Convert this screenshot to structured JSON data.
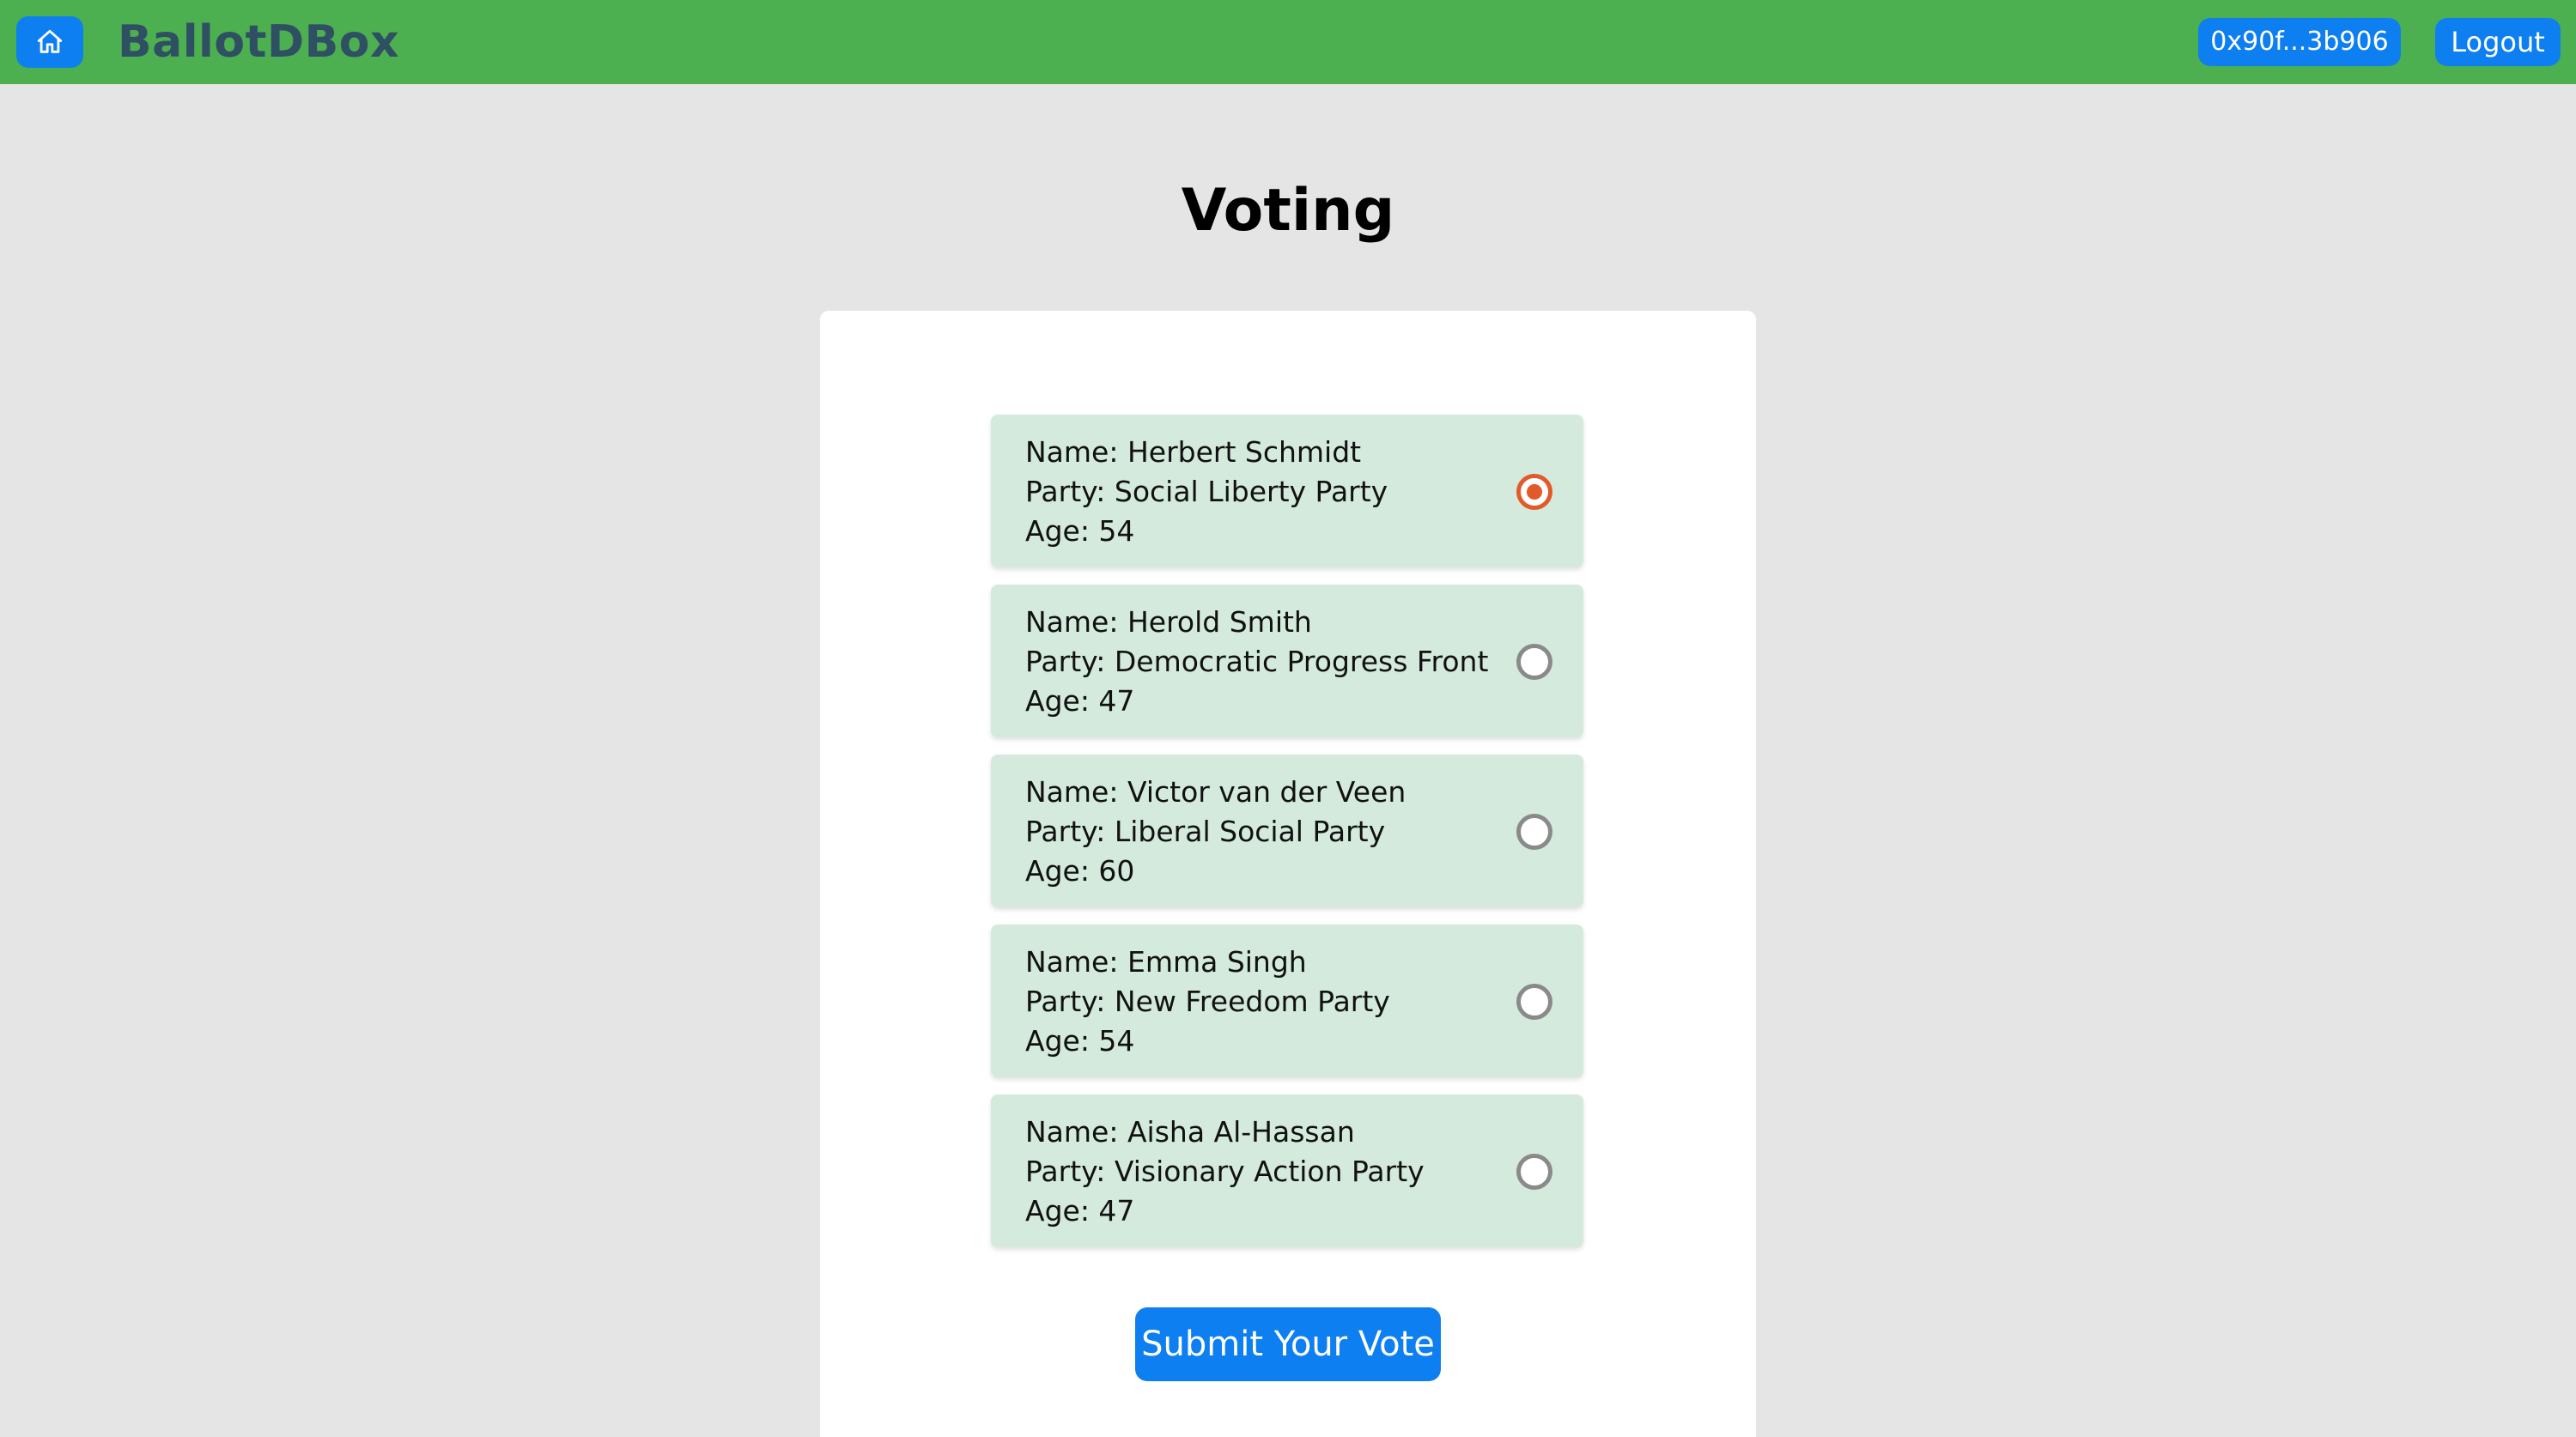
{
  "header": {
    "brand": "BallotDBox",
    "wallet_address": "0x90f...3b906",
    "logout_label": "Logout",
    "home_icon": "home-icon"
  },
  "main": {
    "title": "Voting",
    "submit_label": "Submit Your Vote",
    "candidates": [
      {
        "name": "Name: Herbert Schmidt",
        "party": "Party: Social Liberty Party",
        "age": "Age: 54",
        "selected": true
      },
      {
        "name": "Name: Herold Smith",
        "party": "Party: Democratic Progress Front",
        "age": "Age: 47",
        "selected": false
      },
      {
        "name": "Name: Victor van der Veen",
        "party": "Party: Liberal Social Party",
        "age": "Age: 60",
        "selected": false
      },
      {
        "name": "Name: Emma Singh",
        "party": "Party: New Freedom Party",
        "age": "Age: 54",
        "selected": false
      },
      {
        "name": "Name: Aisha Al-Hassan",
        "party": "Party: Visionary Action Party",
        "age": "Age: 47",
        "selected": false
      }
    ]
  },
  "colors": {
    "header_bg": "#4caf50",
    "button_blue": "#0d7ff0",
    "brand_text": "#2f4f63",
    "card_bg": "#d4eadc",
    "radio_selected": "#e35a2a"
  }
}
